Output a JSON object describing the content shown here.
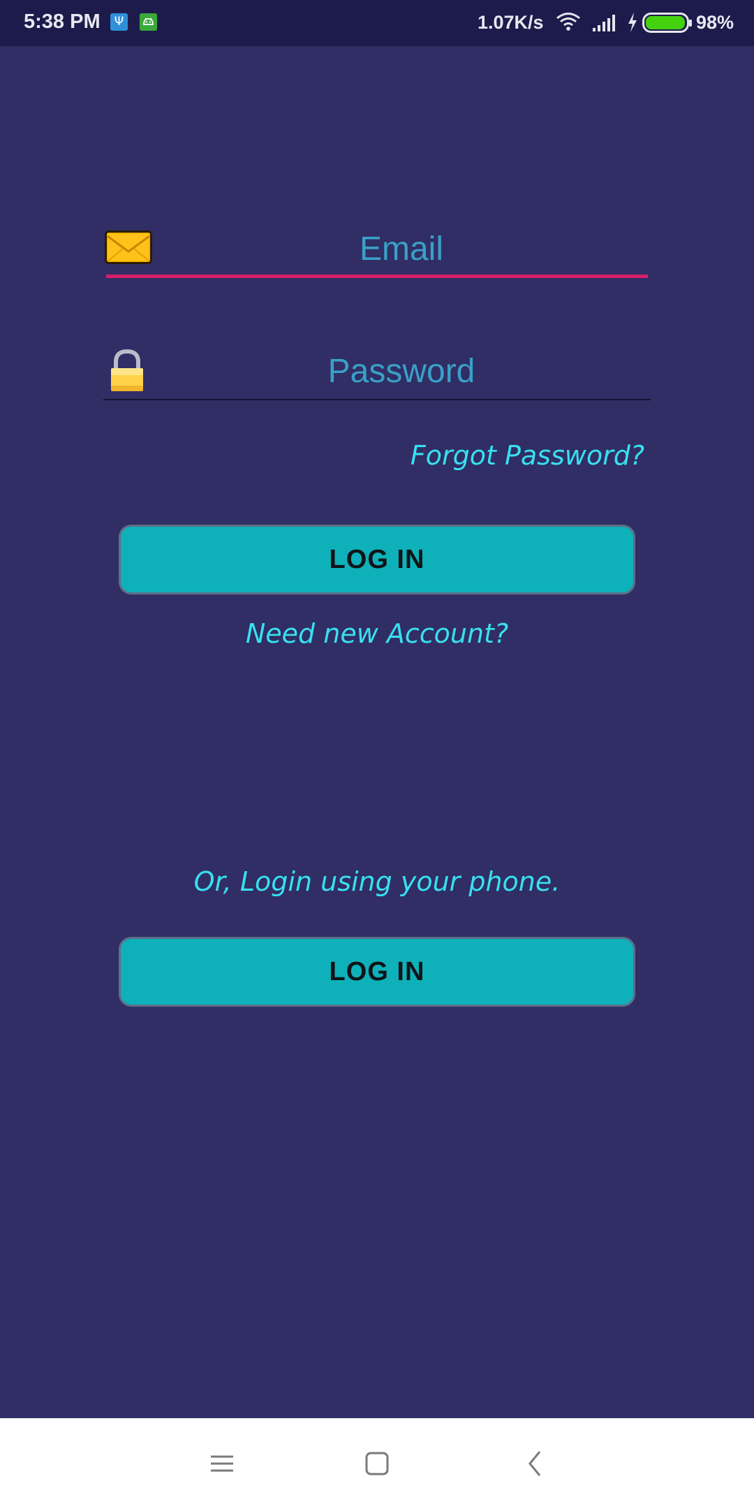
{
  "status_bar": {
    "time": "5:38 PM",
    "usb_icon": "Ψ",
    "network_speed": "1.07K/s",
    "battery_percent": "98%",
    "battery_level": 0.98,
    "battery_color": "#44d20f"
  },
  "login_form": {
    "email_placeholder": "Email",
    "password_placeholder": "Password",
    "forgot_password": "Forgot Password?",
    "login_label": "LOG IN",
    "new_account": "Need new Account?"
  },
  "phone_login": {
    "prompt": "Or, Login using your phone.",
    "login_label": "LOG IN"
  },
  "colors": {
    "background": "#302e64",
    "accent": "#0eb1b9",
    "link": "#38e0f0",
    "email_underline": "#d41f6a",
    "placeholder": "#3aa0c8"
  },
  "nav_bar": {
    "icons": [
      "menu-icon",
      "home-icon",
      "back-icon"
    ]
  }
}
